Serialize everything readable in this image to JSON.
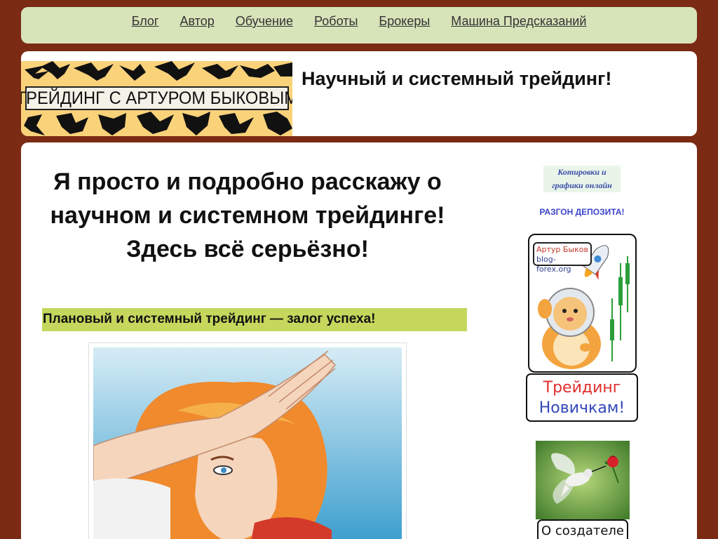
{
  "nav": {
    "items": [
      {
        "label": "Блог"
      },
      {
        "label": "Автор"
      },
      {
        "label": "Обучение"
      },
      {
        "label": "Роботы"
      },
      {
        "label": "Брокеры"
      },
      {
        "label": "Машина Предсказаний"
      }
    ]
  },
  "header": {
    "banner_text": "ТРЕЙДИНГ С АРТУРОМ БЫКОВЫМ",
    "site_title": "Научный и системный трейдинг!"
  },
  "main": {
    "headline": "Я просто и подробно расскажу о научном и системном трейдинге! Здесь всё серьёзно!",
    "subhead": "Плановый и системный трейдинг — залог успеха!"
  },
  "sidebar": {
    "quotes_line1": "Котировки и",
    "quotes_line2": "графики онлайн",
    "razgon": "РАЗГОН ДЕПОЗИТА!",
    "tag_line1": "Артур Быков",
    "tag_line2": "blog-forex.org",
    "newbie_line1": "Трейдинг",
    "newbie_line2": "Новичкам!",
    "creator_label": "О создателе"
  },
  "colors": {
    "page_background": "#7b2a14",
    "nav_background": "#d7e3b9",
    "subhead_background": "#c5d75d",
    "banner_background": "#f9d27a",
    "link_blue": "#3a43c9"
  },
  "icons": [
    "eagle-silhouette-icon",
    "rocket-icon",
    "hamster-astronaut-icon",
    "hummingbird-icon",
    "rose-icon"
  ]
}
